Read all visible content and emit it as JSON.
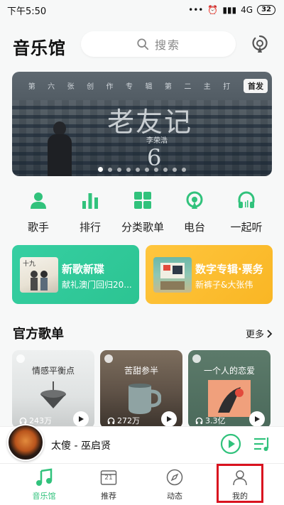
{
  "status": {
    "time": "下午5:50",
    "network": "4G",
    "battery": "32"
  },
  "header": {
    "title": "音乐馆",
    "search_placeholder": "搜索"
  },
  "banner": {
    "strip_text": [
      "第",
      "六",
      "张",
      "创",
      "作",
      "专",
      "辑",
      "第",
      "二",
      "主",
      "打"
    ],
    "badge": "首发",
    "album_title": "老友记",
    "artist": "李荣浩",
    "number": "6",
    "page_count": 10,
    "active_page": 1
  },
  "categories": [
    {
      "label": "歌手",
      "icon": "singer-icon"
    },
    {
      "label": "排行",
      "icon": "chart-bars-icon"
    },
    {
      "label": "分类歌单",
      "icon": "grid-icon"
    },
    {
      "label": "电台",
      "icon": "radio-icon"
    },
    {
      "label": "一起听",
      "icon": "headphones-icon"
    }
  ],
  "promos": [
    {
      "title": "新歌新碟",
      "subtitle": "献礼澳门回归20...",
      "color": "#2ec896"
    },
    {
      "title": "数字专辑·票务",
      "subtitle": "新裤子&大张伟",
      "color": "#fbbf2f"
    }
  ],
  "official": {
    "title": "官方歌单",
    "more": "更多",
    "playlists": [
      {
        "name": "情感平衡点",
        "plays": "243万"
      },
      {
        "name": "苦甜参半",
        "plays": "272万"
      },
      {
        "name": "一个人的恋爱",
        "plays": "3.3亿"
      }
    ]
  },
  "player": {
    "song": "太傻 - 巫启贤"
  },
  "tabs": [
    {
      "label": "音乐馆",
      "icon": "music-note-icon",
      "active": true
    },
    {
      "label": "推荐",
      "icon": "calendar-icon",
      "badge": "21"
    },
    {
      "label": "动态",
      "icon": "compass-icon"
    },
    {
      "label": "我的",
      "icon": "profile-icon"
    }
  ],
  "colors": {
    "accent": "#31c27c",
    "highlight": "#d9121f"
  }
}
